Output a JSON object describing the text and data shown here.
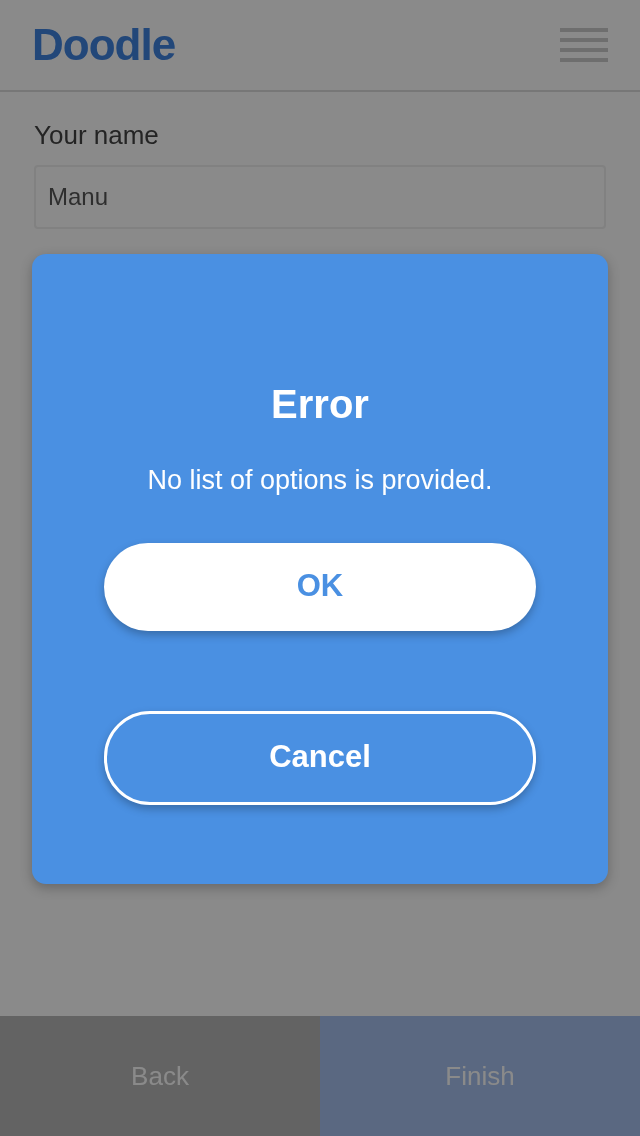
{
  "header": {
    "logo": "Doodle"
  },
  "form": {
    "label": "Your name",
    "value": "Manu"
  },
  "footer": [
    {
      "label": "Back",
      "kind": "secondary"
    },
    {
      "label": "Finish",
      "kind": "primary"
    }
  ],
  "dialog": {
    "title": "Error",
    "message": "No list of options is provided.",
    "buttons": [
      {
        "label": "OK",
        "kind": "filled"
      },
      {
        "label": "Cancel",
        "kind": "outline"
      }
    ]
  }
}
